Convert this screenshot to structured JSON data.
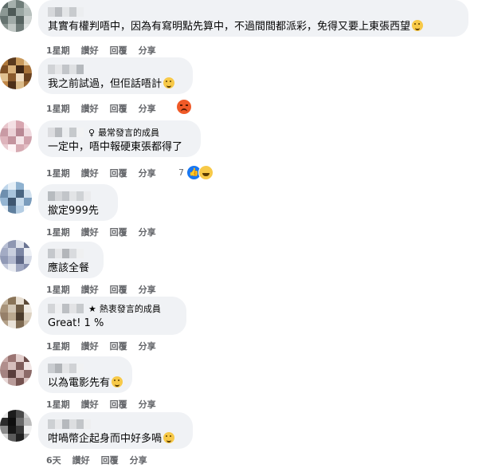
{
  "comments": [
    {
      "text": "其實有權判唔中，因為有寫明點先算中，不過間間都派彩，免得又要上東張西望",
      "emoji": "grinning-sweat-emoji",
      "actions": {
        "time": "1星期",
        "like": "讚好",
        "reply": "回覆",
        "share": "分享"
      }
    },
    {
      "text": "我之前試過，但佢話唔計",
      "emoji": "sweat-smile-emoji",
      "actions": {
        "time": "1星期",
        "like": "讚好",
        "reply": "回覆",
        "share": "分享"
      },
      "reaction": {
        "icons": [
          "angry-reaction-icon"
        ],
        "count": ""
      }
    },
    {
      "badge": "最常發言的成員",
      "badge_icon": "award-ribbon-icon",
      "text": "一定中，唔中報硬東張都得了",
      "actions": {
        "time": "1星期",
        "like": "讚好",
        "reply": "回覆",
        "share": "分享"
      },
      "reaction": {
        "icons": [
          "like-reaction-icon",
          "haha-reaction-icon"
        ],
        "count": "7"
      }
    },
    {
      "text": "撳定999先",
      "actions": {
        "time": "1星期",
        "like": "讚好",
        "reply": "回覆",
        "share": "分享"
      }
    },
    {
      "text": "應該全餐",
      "actions": {
        "time": "1星期",
        "like": "讚好",
        "reply": "回覆",
        "share": "分享"
      }
    },
    {
      "badge": "熱衷發言的成員",
      "badge_icon": "star-icon",
      "text": "Great! 1 %",
      "actions": {
        "time": "1星期",
        "like": "讚好",
        "reply": "回覆",
        "share": "分享"
      }
    },
    {
      "text": "以為電影先有",
      "emoji": "laughing-emoji",
      "actions": {
        "time": "1星期",
        "like": "讚好",
        "reply": "回覆",
        "share": "分享"
      }
    },
    {
      "text": "咁喎幣企起身而中好多喎",
      "emoji": "shocked-emoji",
      "actions": {
        "time": "6天",
        "like": "讚好",
        "reply": "回覆",
        "share": "分享"
      }
    }
  ],
  "colors": {
    "bubble": "#f0f2f5",
    "meta": "#65676b",
    "like_blue": "#1877f2",
    "angry": "#f05a28",
    "emoji_yellow": "#f7c948"
  }
}
